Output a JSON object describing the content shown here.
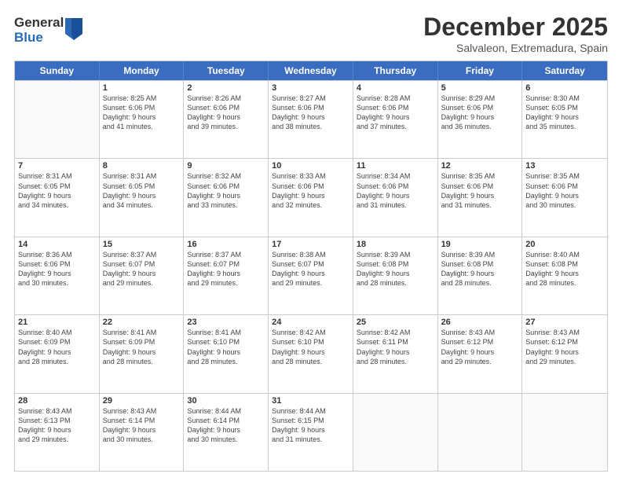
{
  "logo": {
    "general": "General",
    "blue": "Blue"
  },
  "title": "December 2025",
  "subtitle": "Salvaleon, Extremadura, Spain",
  "header_days": [
    "Sunday",
    "Monday",
    "Tuesday",
    "Wednesday",
    "Thursday",
    "Friday",
    "Saturday"
  ],
  "rows": [
    [
      {
        "day": "",
        "lines": []
      },
      {
        "day": "1",
        "lines": [
          "Sunrise: 8:25 AM",
          "Sunset: 6:06 PM",
          "Daylight: 9 hours",
          "and 41 minutes."
        ]
      },
      {
        "day": "2",
        "lines": [
          "Sunrise: 8:26 AM",
          "Sunset: 6:06 PM",
          "Daylight: 9 hours",
          "and 39 minutes."
        ]
      },
      {
        "day": "3",
        "lines": [
          "Sunrise: 8:27 AM",
          "Sunset: 6:06 PM",
          "Daylight: 9 hours",
          "and 38 minutes."
        ]
      },
      {
        "day": "4",
        "lines": [
          "Sunrise: 8:28 AM",
          "Sunset: 6:06 PM",
          "Daylight: 9 hours",
          "and 37 minutes."
        ]
      },
      {
        "day": "5",
        "lines": [
          "Sunrise: 8:29 AM",
          "Sunset: 6:06 PM",
          "Daylight: 9 hours",
          "and 36 minutes."
        ]
      },
      {
        "day": "6",
        "lines": [
          "Sunrise: 8:30 AM",
          "Sunset: 6:05 PM",
          "Daylight: 9 hours",
          "and 35 minutes."
        ]
      }
    ],
    [
      {
        "day": "7",
        "lines": [
          "Sunrise: 8:31 AM",
          "Sunset: 6:05 PM",
          "Daylight: 9 hours",
          "and 34 minutes."
        ]
      },
      {
        "day": "8",
        "lines": [
          "Sunrise: 8:31 AM",
          "Sunset: 6:05 PM",
          "Daylight: 9 hours",
          "and 34 minutes."
        ]
      },
      {
        "day": "9",
        "lines": [
          "Sunrise: 8:32 AM",
          "Sunset: 6:06 PM",
          "Daylight: 9 hours",
          "and 33 minutes."
        ]
      },
      {
        "day": "10",
        "lines": [
          "Sunrise: 8:33 AM",
          "Sunset: 6:06 PM",
          "Daylight: 9 hours",
          "and 32 minutes."
        ]
      },
      {
        "day": "11",
        "lines": [
          "Sunrise: 8:34 AM",
          "Sunset: 6:06 PM",
          "Daylight: 9 hours",
          "and 31 minutes."
        ]
      },
      {
        "day": "12",
        "lines": [
          "Sunrise: 8:35 AM",
          "Sunset: 6:06 PM",
          "Daylight: 9 hours",
          "and 31 minutes."
        ]
      },
      {
        "day": "13",
        "lines": [
          "Sunrise: 8:35 AM",
          "Sunset: 6:06 PM",
          "Daylight: 9 hours",
          "and 30 minutes."
        ]
      }
    ],
    [
      {
        "day": "14",
        "lines": [
          "Sunrise: 8:36 AM",
          "Sunset: 6:06 PM",
          "Daylight: 9 hours",
          "and 30 minutes."
        ]
      },
      {
        "day": "15",
        "lines": [
          "Sunrise: 8:37 AM",
          "Sunset: 6:07 PM",
          "Daylight: 9 hours",
          "and 29 minutes."
        ]
      },
      {
        "day": "16",
        "lines": [
          "Sunrise: 8:37 AM",
          "Sunset: 6:07 PM",
          "Daylight: 9 hours",
          "and 29 minutes."
        ]
      },
      {
        "day": "17",
        "lines": [
          "Sunrise: 8:38 AM",
          "Sunset: 6:07 PM",
          "Daylight: 9 hours",
          "and 29 minutes."
        ]
      },
      {
        "day": "18",
        "lines": [
          "Sunrise: 8:39 AM",
          "Sunset: 6:08 PM",
          "Daylight: 9 hours",
          "and 28 minutes."
        ]
      },
      {
        "day": "19",
        "lines": [
          "Sunrise: 8:39 AM",
          "Sunset: 6:08 PM",
          "Daylight: 9 hours",
          "and 28 minutes."
        ]
      },
      {
        "day": "20",
        "lines": [
          "Sunrise: 8:40 AM",
          "Sunset: 6:08 PM",
          "Daylight: 9 hours",
          "and 28 minutes."
        ]
      }
    ],
    [
      {
        "day": "21",
        "lines": [
          "Sunrise: 8:40 AM",
          "Sunset: 6:09 PM",
          "Daylight: 9 hours",
          "and 28 minutes."
        ]
      },
      {
        "day": "22",
        "lines": [
          "Sunrise: 8:41 AM",
          "Sunset: 6:09 PM",
          "Daylight: 9 hours",
          "and 28 minutes."
        ]
      },
      {
        "day": "23",
        "lines": [
          "Sunrise: 8:41 AM",
          "Sunset: 6:10 PM",
          "Daylight: 9 hours",
          "and 28 minutes."
        ]
      },
      {
        "day": "24",
        "lines": [
          "Sunrise: 8:42 AM",
          "Sunset: 6:10 PM",
          "Daylight: 9 hours",
          "and 28 minutes."
        ]
      },
      {
        "day": "25",
        "lines": [
          "Sunrise: 8:42 AM",
          "Sunset: 6:11 PM",
          "Daylight: 9 hours",
          "and 28 minutes."
        ]
      },
      {
        "day": "26",
        "lines": [
          "Sunrise: 8:43 AM",
          "Sunset: 6:12 PM",
          "Daylight: 9 hours",
          "and 29 minutes."
        ]
      },
      {
        "day": "27",
        "lines": [
          "Sunrise: 8:43 AM",
          "Sunset: 6:12 PM",
          "Daylight: 9 hours",
          "and 29 minutes."
        ]
      }
    ],
    [
      {
        "day": "28",
        "lines": [
          "Sunrise: 8:43 AM",
          "Sunset: 6:13 PM",
          "Daylight: 9 hours",
          "and 29 minutes."
        ]
      },
      {
        "day": "29",
        "lines": [
          "Sunrise: 8:43 AM",
          "Sunset: 6:14 PM",
          "Daylight: 9 hours",
          "and 30 minutes."
        ]
      },
      {
        "day": "30",
        "lines": [
          "Sunrise: 8:44 AM",
          "Sunset: 6:14 PM",
          "Daylight: 9 hours",
          "and 30 minutes."
        ]
      },
      {
        "day": "31",
        "lines": [
          "Sunrise: 8:44 AM",
          "Sunset: 6:15 PM",
          "Daylight: 9 hours",
          "and 31 minutes."
        ]
      },
      {
        "day": "",
        "lines": []
      },
      {
        "day": "",
        "lines": []
      },
      {
        "day": "",
        "lines": []
      }
    ]
  ]
}
